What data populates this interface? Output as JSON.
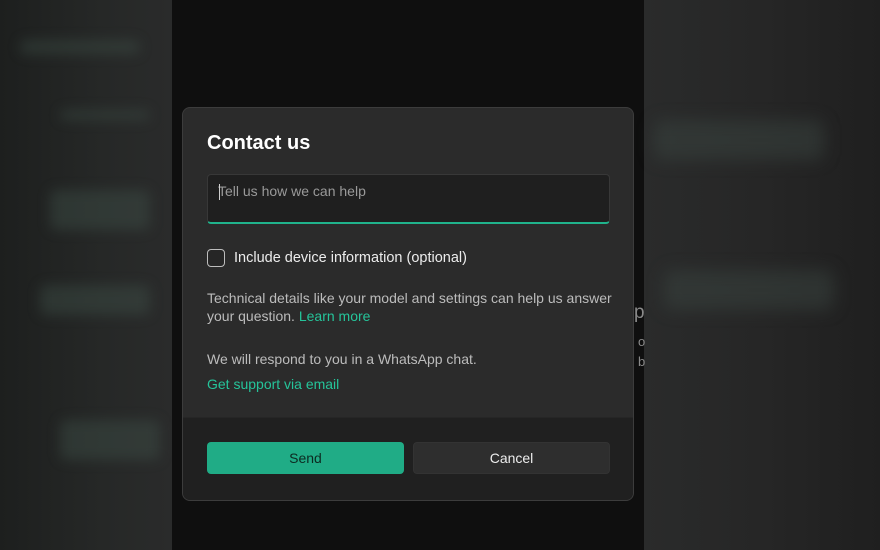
{
  "background": {
    "peek_letter": "p",
    "peek_fragment_1": "o",
    "peek_fragment_2": "b"
  },
  "dialog": {
    "title": "Contact us",
    "message_placeholder": "Tell us how we can help",
    "checkbox_label": "Include device information (optional)",
    "checkbox_checked": false,
    "help_text": "Technical details like your model and settings can help us answer your question.",
    "learn_more_link": "Learn more",
    "respond_text": "We will respond to you in a WhatsApp chat.",
    "email_link": "Get support via email",
    "send_label": "Send",
    "cancel_label": "Cancel"
  },
  "colors": {
    "accent": "#20ac86",
    "link": "#25c49a",
    "dialog_bg": "#2b2b2b",
    "footer_bg": "#202020"
  }
}
